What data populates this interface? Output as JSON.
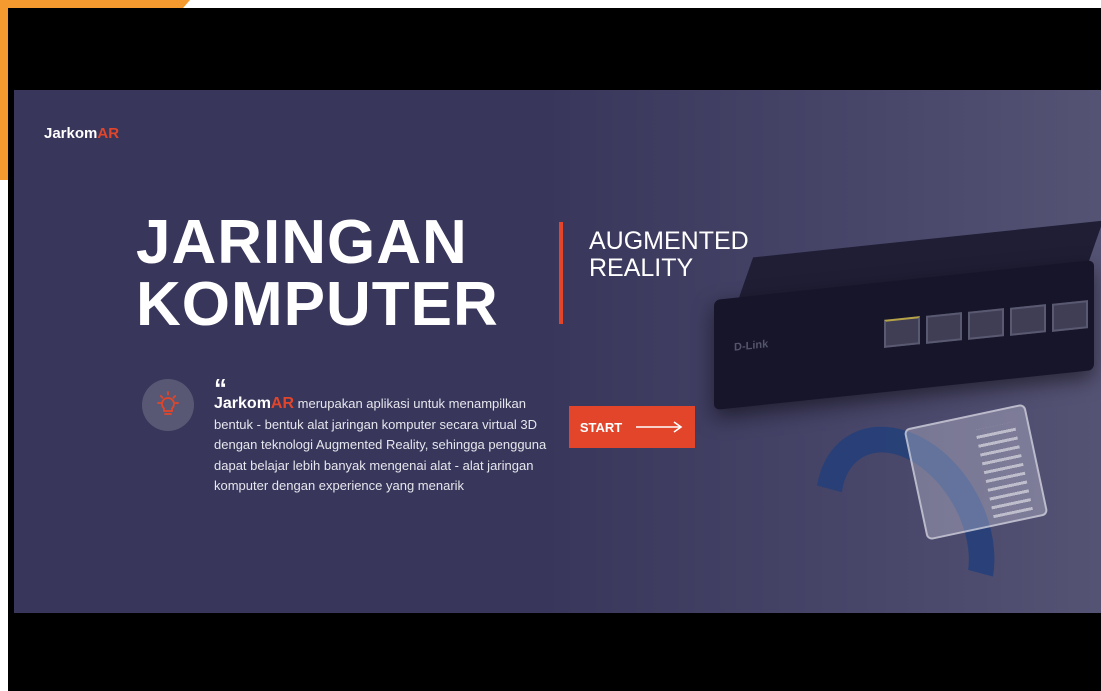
{
  "logo": {
    "main": "Jarkom",
    "accent": "AR"
  },
  "headline": {
    "line1": "JARINGAN",
    "line2": "KOMPUTER"
  },
  "subtitle": {
    "line1": "AUGMENTED",
    "line2": "REALITY"
  },
  "description": {
    "quote_mark": "“",
    "app_name": "Jarkom",
    "app_accent": "AR",
    "text": " merupakan aplikasi untuk menampilkan bentuk - bentuk alat jaringan komputer secara virtual 3D dengan teknologi Augmented Reality, sehingga pengguna dapat belajar lebih banyak mengenai alat - alat jaringan komputer dengan experience yang menarik"
  },
  "start_button": {
    "label": "START",
    "icon": "arrow-right-icon"
  },
  "device_brand": "D-Link",
  "icons": {
    "idea": "lightbulb-icon"
  },
  "colors": {
    "accent": "#e2452a",
    "background": "#38365a",
    "text": "#ffffff"
  }
}
